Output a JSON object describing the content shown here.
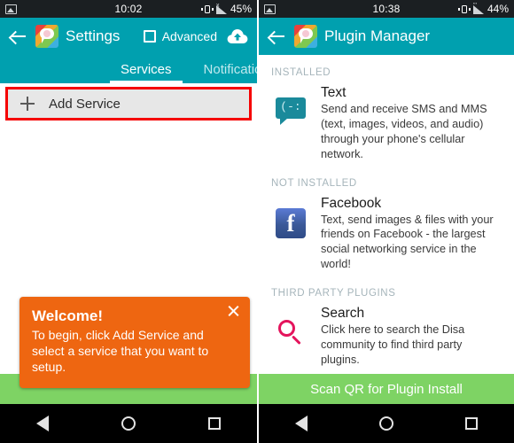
{
  "left_screen": {
    "statusbar": {
      "photo_icon": "photo-icon",
      "clock": "10:02",
      "vibrate_icon": "vibrate-icon",
      "signal_icon": "signal-icon",
      "battery": "45%"
    },
    "appbar": {
      "back_icon": "back-arrow-icon",
      "logo": "disa-logo",
      "title": "Settings",
      "checkbox_label": "Advanced",
      "checkbox_checked": false,
      "cloud_icon": "cloud-upload-icon"
    },
    "tabs": [
      {
        "label": "Services",
        "active": true
      },
      {
        "label": "Notifications",
        "active": false
      }
    ],
    "add_service": {
      "plus_icon": "plus-icon",
      "label": "Add Service",
      "highlight_color": "#f50000",
      "background": "#e7e7e7"
    },
    "tooltip": {
      "title": "Welcome!",
      "body": "To begin, click Add Service and select a service that you want to setup.",
      "close_icon": "close-icon",
      "color": "#ee6611"
    },
    "green_bar_color": "#7ed364",
    "navbar": {
      "back": "nav-back-icon",
      "home": "nav-home-icon",
      "recent": "nav-recent-icon"
    }
  },
  "right_screen": {
    "statusbar": {
      "photo_icon": "photo-icon",
      "clock": "10:38",
      "vibrate_icon": "vibrate-icon",
      "signal_icon": "signal-icon",
      "battery": "44%"
    },
    "appbar": {
      "back_icon": "back-arrow-icon",
      "logo": "disa-logo",
      "title": "Plugin Manager"
    },
    "sections": [
      {
        "header": "INSTALLED",
        "items": [
          {
            "icon": "text-bubble-icon",
            "icon_glyph": "(-:",
            "name": "Text",
            "description": "Send and receive SMS and MMS (text, images, videos, and audio) through your phone's cellular network."
          }
        ]
      },
      {
        "header": "NOT INSTALLED",
        "items": [
          {
            "icon": "facebook-icon",
            "icon_glyph": "f",
            "name": "Facebook",
            "description": "Text, send images & files with your friends on Facebook - the largest social networking service in the world!"
          }
        ]
      },
      {
        "header": "THIRD PARTY PLUGINS",
        "items": [
          {
            "icon": "search-icon",
            "icon_glyph": "",
            "name": "Search",
            "description": "Click here to search the Disa community to find third party plugins."
          }
        ]
      }
    ],
    "action_bar": {
      "label": "Scan QR for Plugin Install",
      "color": "#7ed364"
    },
    "navbar": {
      "back": "nav-back-icon",
      "home": "nav-home-icon",
      "recent": "nav-recent-icon"
    }
  }
}
